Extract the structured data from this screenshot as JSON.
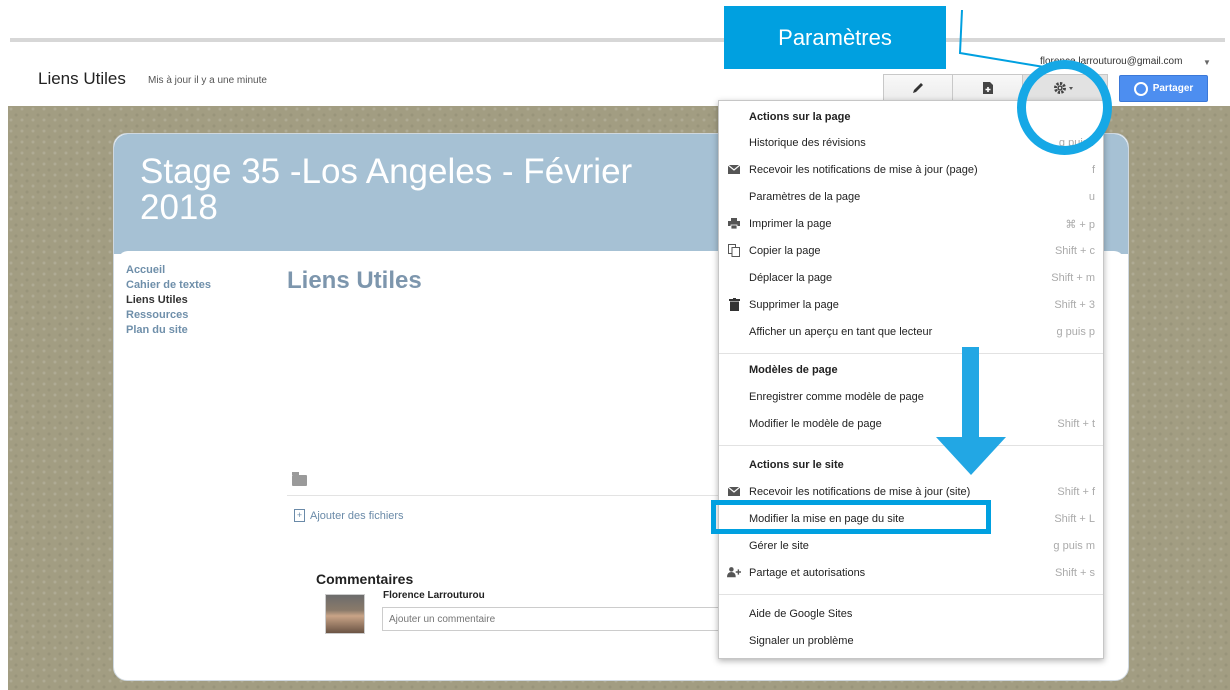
{
  "app": {
    "site_name": "Liens Utiles",
    "last_updated": "Mis à jour il y a une minute",
    "user_email": "florence.larrouturou@gmail.com",
    "share_label": "Partager"
  },
  "toolbar": {
    "edit_icon": "pencil-icon",
    "new_page_icon": "new-page-icon",
    "settings_icon": "gear-icon"
  },
  "site": {
    "header_title": "Stage 35 -Los Angeles - Février 2018",
    "nav": [
      "Accueil",
      "Cahier de textes",
      "Liens Utiles",
      "Ressources",
      "Plan du site"
    ],
    "current_page": "Liens Utiles",
    "page_title": "Liens Utiles",
    "add_files": "Ajouter des fichiers",
    "comments_title": "Commentaires",
    "comment_author": "Florence Larrouturou",
    "comment_placeholder": "Ajouter un commentaire"
  },
  "menu": {
    "sections": [
      {
        "title": "Actions sur la page",
        "items": [
          {
            "label": "Historique des révisions",
            "shortcut": "g puis r",
            "icon": ""
          },
          {
            "label": "Recevoir les notifications de mise à jour (page)",
            "shortcut": "f",
            "icon": "mail-icon"
          },
          {
            "label": "Paramètres de la page",
            "shortcut": "u",
            "icon": ""
          },
          {
            "label": "Imprimer la page",
            "shortcut": "⌘ + p",
            "icon": "print-icon"
          },
          {
            "label": "Copier la page",
            "shortcut": "Shift + c",
            "icon": "copy-icon"
          },
          {
            "label": "Déplacer la page",
            "shortcut": "Shift + m",
            "icon": ""
          },
          {
            "label": "Supprimer la page",
            "shortcut": "Shift + 3",
            "icon": "trash-icon"
          },
          {
            "label": "Afficher un aperçu en tant que lecteur",
            "shortcut": "g puis p",
            "icon": ""
          }
        ]
      },
      {
        "title": "Modèles de page",
        "items": [
          {
            "label": "Enregistrer comme modèle de page",
            "shortcut": "",
            "icon": ""
          },
          {
            "label": "Modifier le modèle de page",
            "shortcut": "Shift + t",
            "icon": ""
          }
        ]
      },
      {
        "title": "Actions sur le site",
        "items": [
          {
            "label": "Recevoir les notifications de mise à jour (site)",
            "shortcut": "Shift + f",
            "icon": "mail-icon"
          },
          {
            "label": "Modifier la mise en page du site",
            "shortcut": "Shift + L",
            "icon": ""
          },
          {
            "label": "Gérer le site",
            "shortcut": "g puis m",
            "icon": ""
          },
          {
            "label": "Partage et autorisations",
            "shortcut": "Shift + s",
            "icon": "add-person-icon"
          }
        ]
      }
    ],
    "footer_items": [
      {
        "label": "Aide de Google Sites"
      },
      {
        "label": "Signaler un problème"
      }
    ]
  },
  "annotations": {
    "callout_label": "Paramètres",
    "color": "#00a0e0"
  }
}
